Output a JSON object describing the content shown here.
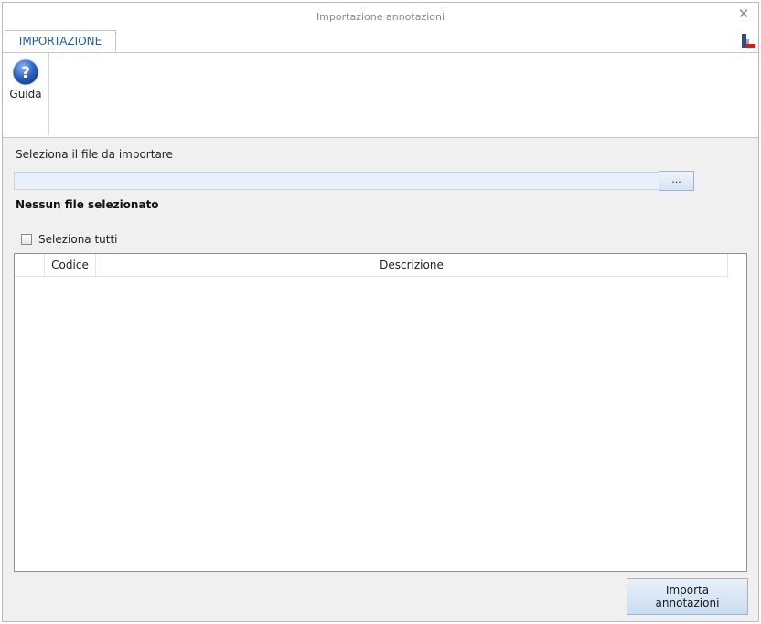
{
  "window": {
    "title": "Importazione annotazioni"
  },
  "ribbon": {
    "tabs": [
      {
        "label": "IMPORTAZIONE"
      }
    ],
    "help_button": {
      "label": "Guida",
      "icon": "help-icon"
    }
  },
  "file_section": {
    "label": "Seleziona il file da importare",
    "input_value": "",
    "browse_label": "...",
    "status": "Nessun file selezionato"
  },
  "select_all": {
    "label": "Seleziona tutti",
    "checked": false
  },
  "grid": {
    "columns": [
      "",
      "Codice",
      "Descrizione"
    ],
    "rows": []
  },
  "actions": {
    "import_label_line1": "Importa",
    "import_label_line2": "annotazioni"
  },
  "colors": {
    "tab_text": "#2a5d97",
    "input_bg": "#e8f0fb",
    "button_gradient_top": "#e9f0fa",
    "button_gradient_bottom": "#cbdcf1"
  }
}
